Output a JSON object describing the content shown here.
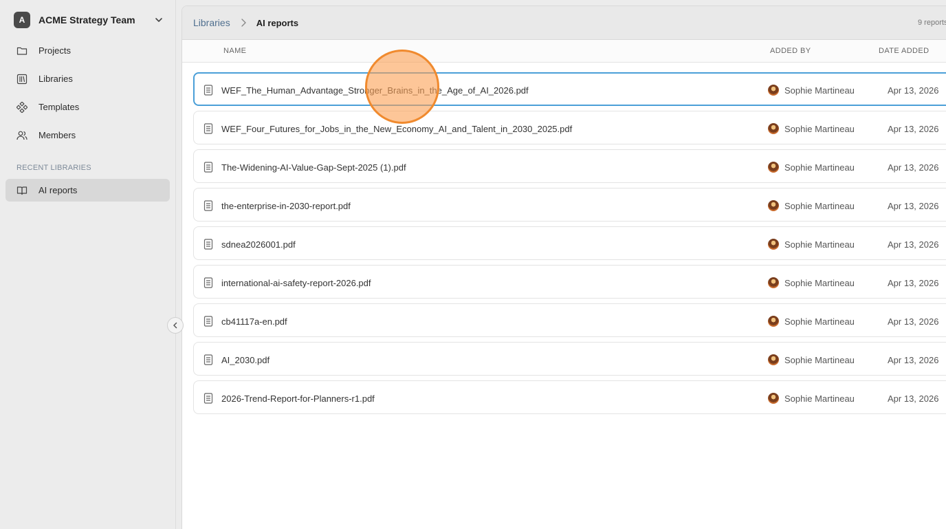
{
  "team": {
    "initial": "A",
    "name": "ACME Strategy Team"
  },
  "nav": [
    {
      "label": "Projects",
      "icon": "folder-icon"
    },
    {
      "label": "Libraries",
      "icon": "library-icon"
    },
    {
      "label": "Templates",
      "icon": "templates-icon"
    },
    {
      "label": "Members",
      "icon": "members-icon"
    }
  ],
  "recent": {
    "section_label": "RECENT LIBRARIES",
    "items": [
      {
        "label": "AI reports",
        "icon": "book-icon"
      }
    ]
  },
  "breadcrumb": {
    "parent": "Libraries",
    "current": "AI reports"
  },
  "count_label": "9 reports",
  "table": {
    "headers": {
      "name": "NAME",
      "added_by": "ADDED BY",
      "date_added": "DATE ADDED"
    },
    "rows": [
      {
        "name": "WEF_The_Human_Advantage_Stronger_Brains_in_the_Age_of_AI_2026.pdf",
        "added_by": "Sophie Martineau",
        "date": "Apr 13, 2026",
        "selected": true
      },
      {
        "name": "WEF_Four_Futures_for_Jobs_in_the_New_Economy_AI_and_Talent_in_2030_2025.pdf",
        "added_by": "Sophie Martineau",
        "date": "Apr 13, 2026"
      },
      {
        "name": "The-Widening-AI-Value-Gap-Sept-2025 (1).pdf",
        "added_by": "Sophie Martineau",
        "date": "Apr 13, 2026"
      },
      {
        "name": "the-enterprise-in-2030-report.pdf",
        "added_by": "Sophie Martineau",
        "date": "Apr 13, 2026"
      },
      {
        "name": "sdnea2026001.pdf",
        "added_by": "Sophie Martineau",
        "date": "Apr 13, 2026"
      },
      {
        "name": "international-ai-safety-report-2026.pdf",
        "added_by": "Sophie Martineau",
        "date": "Apr 13, 2026"
      },
      {
        "name": "cb41117a-en.pdf",
        "added_by": "Sophie Martineau",
        "date": "Apr 13, 2026"
      },
      {
        "name": "AI_2030.pdf",
        "added_by": "Sophie Martineau",
        "date": "Apr 13, 2026"
      },
      {
        "name": "2026-Trend-Report-for-Planners-r1.pdf",
        "added_by": "Sophie Martineau",
        "date": "Apr 13, 2026"
      }
    ]
  },
  "colors": {
    "accent": "#4a9fd8",
    "link": "#4f6f8f",
    "cursor_highlight": "#f08a2e"
  }
}
